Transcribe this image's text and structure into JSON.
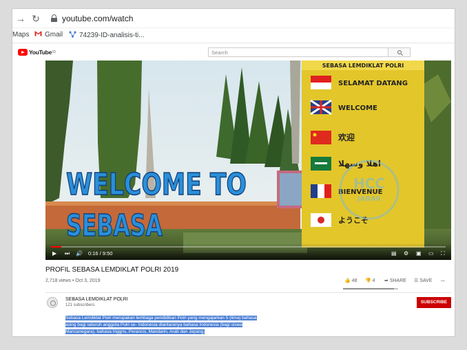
{
  "browser": {
    "url": "youtube.com/watch",
    "bookmarks": [
      "Maps",
      "Gmail",
      "74239-ID-analisis-ti..."
    ]
  },
  "youtube": {
    "logo_text": "YouTube",
    "logo_sup": "ID",
    "search_placeholder": "Search"
  },
  "video": {
    "overlay_line1": "WELCOME TO",
    "overlay_line2": "SEBASA",
    "sign_title": "SEBASA LEMDIKLAT POLRI",
    "sign_greetings": [
      "SELAMAT DATANG",
      "WELCOME",
      "欢迎",
      "اهلا وسهلا",
      "BIENVENUE",
      "ようこそ"
    ],
    "watermark": "HCC",
    "watermark_sub": "JABAR",
    "current_time": "0:16",
    "duration": "9:50",
    "progress_fraction": 0.027
  },
  "info": {
    "title": "PROFIL SEBASA LEMDIKLAT POLRI 2019",
    "views_date": "2,718 views • Oct 3, 2019",
    "likes": "48",
    "dislikes": "4",
    "share_label": "SHARE",
    "save_label": "SAVE",
    "more_label": "...",
    "like_ratio": 0.92
  },
  "channel": {
    "name": "SEBASA LEMDIKLAT POLRI",
    "subscribers": "121 subscribers",
    "subscribe_label": "SUBSCRIBE"
  },
  "description": {
    "line1": "Sebasa Lemdiklat Polri merupakan lembaga pendidikan Polri yang mengajarkan 5 (lima) bahasa",
    "line2": "asing bagi seluruh anggota Polri se- Indonesia diantaranya bahasa Indonesia (bagi siswa",
    "line3": "Mancanegara), bahasa Inggris, Perancis, Mandarin, Arab dan Jepang."
  },
  "colors": {
    "youtube_red": "#ff0000",
    "subscribe_red": "#cc0000",
    "selection_blue": "#4a7fd4",
    "sign_yellow": "#e8cc2a",
    "overlay_blue": "#2a8fd8"
  }
}
